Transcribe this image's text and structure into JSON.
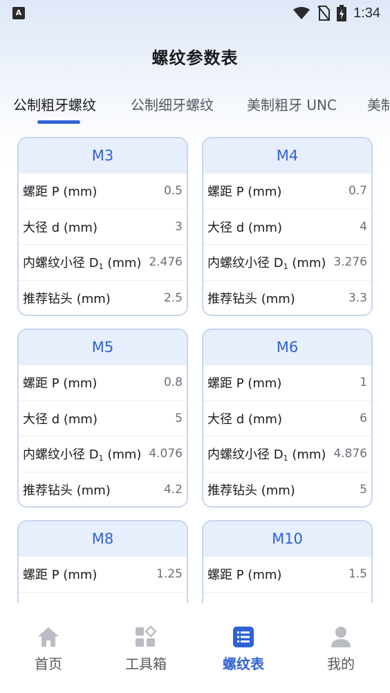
{
  "status_bar": {
    "time": "1:34",
    "app_badge": "A"
  },
  "page_title": "螺纹参数表",
  "tabs": [
    "公制粗牙螺纹",
    "公制细牙螺纹",
    "美制粗牙 UNC",
    "美制"
  ],
  "cards": [
    {
      "title": "M3",
      "rows": [
        {
          "label": "螺距 P (mm)",
          "value": "0.5"
        },
        {
          "label": "大径 d (mm)",
          "value": "3"
        },
        {
          "label_main": "内螺纹小径 D",
          "label_sub": "1",
          "label_end": " (mm)",
          "value": "2.476"
        },
        {
          "label": "推荐钻头 (mm)",
          "value": "2.5"
        }
      ]
    },
    {
      "title": "M4",
      "rows": [
        {
          "label": "螺距 P (mm)",
          "value": "0.7"
        },
        {
          "label": "大径 d (mm)",
          "value": "4"
        },
        {
          "label_main": "内螺纹小径 D",
          "label_sub": "1",
          "label_end": " (mm)",
          "value": "3.276"
        },
        {
          "label": "推荐钻头 (mm)",
          "value": "3.3"
        }
      ]
    },
    {
      "title": "M5",
      "rows": [
        {
          "label": "螺距 P (mm)",
          "value": "0.8"
        },
        {
          "label": "大径 d (mm)",
          "value": "5"
        },
        {
          "label_main": "内螺纹小径 D",
          "label_sub": "1",
          "label_end": " (mm)",
          "value": "4.076"
        },
        {
          "label": "推荐钻头 (mm)",
          "value": "4.2"
        }
      ]
    },
    {
      "title": "M6",
      "rows": [
        {
          "label": "螺距 P (mm)",
          "value": "1"
        },
        {
          "label": "大径 d (mm)",
          "value": "6"
        },
        {
          "label_main": "内螺纹小径 D",
          "label_sub": "1",
          "label_end": " (mm)",
          "value": "4.876"
        },
        {
          "label": "推荐钻头 (mm)",
          "value": "5"
        }
      ]
    },
    {
      "title": "M8",
      "rows": [
        {
          "label": "螺距 P (mm)",
          "value": "1.25"
        }
      ]
    },
    {
      "title": "M10",
      "rows": [
        {
          "label": "螺距 P (mm)",
          "value": "1.5"
        }
      ]
    }
  ],
  "nav": [
    {
      "label": "首页",
      "icon": "home-icon"
    },
    {
      "label": "工具箱",
      "icon": "toolbox-icon"
    },
    {
      "label": "螺纹表",
      "icon": "list-icon",
      "active": true
    },
    {
      "label": "我的",
      "icon": "person-icon"
    }
  ],
  "colors": {
    "accent": "#2f62d6",
    "card_head": "#e7eefc",
    "card_border": "#c6d5ef"
  }
}
